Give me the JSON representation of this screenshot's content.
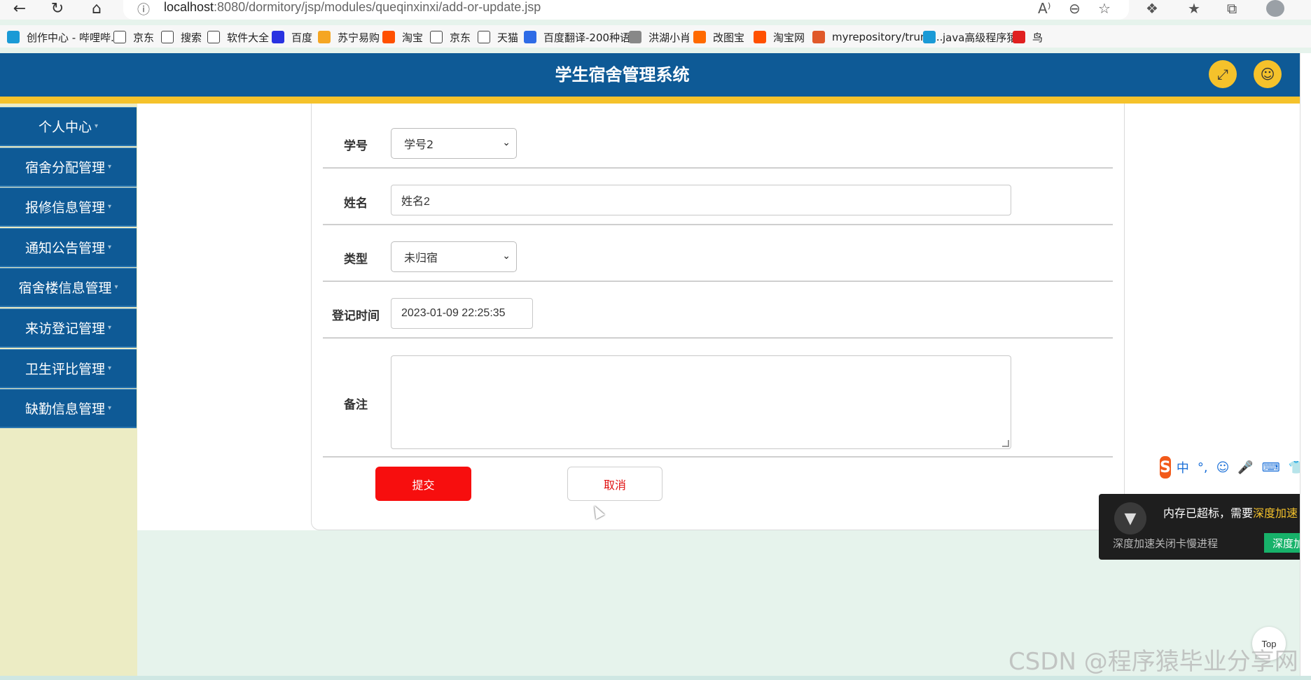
{
  "browser": {
    "url_host": "localhost",
    "url_rest": ":8080/dormitory/jsp/modules/queqinxinxi/add-or-update.jsp",
    "bookmarks": [
      {
        "label": "创作中心 - 哔哩哔...",
        "color": "#1a9ad6"
      },
      {
        "label": "京东",
        "color": "#ffffff"
      },
      {
        "label": "搜索",
        "color": "#ffffff"
      },
      {
        "label": "软件大全",
        "color": "#ffffff"
      },
      {
        "label": "百度",
        "color": "#2932e1"
      },
      {
        "label": "苏宁易购",
        "color": "#f5a623"
      },
      {
        "label": "淘宝",
        "color": "#ff5000"
      },
      {
        "label": "京东",
        "color": "#ffffff"
      },
      {
        "label": "天猫",
        "color": "#ffffff"
      },
      {
        "label": "百度翻译-200种语...",
        "color": "#2e6be6"
      },
      {
        "label": "洪湖小肖",
        "color": "#888888"
      },
      {
        "label": "改图宝",
        "color": "#ff6a00"
      },
      {
        "label": "淘宝网",
        "color": "#ff5000"
      },
      {
        "label": "myrepository/trunk...",
        "color": "#e0592a"
      },
      {
        "label": "java高级程序猿",
        "color": "#1a9ad6"
      },
      {
        "label": "鸟",
        "color": "#e02020"
      }
    ]
  },
  "app": {
    "title": "学生宿舍管理系统"
  },
  "sidebar": {
    "items": [
      {
        "label": "个人中心"
      },
      {
        "label": "宿舍分配管理"
      },
      {
        "label": "报修信息管理"
      },
      {
        "label": "通知公告管理"
      },
      {
        "label": "宿舍楼信息管理"
      },
      {
        "label": "来访登记管理"
      },
      {
        "label": "卫生评比管理"
      },
      {
        "label": "缺勤信息管理"
      }
    ]
  },
  "form": {
    "student_id": {
      "label": "学号",
      "value": "学号2"
    },
    "name": {
      "label": "姓名",
      "value": "姓名2"
    },
    "type": {
      "label": "类型",
      "value": "未归宿"
    },
    "time": {
      "label": "登记时间",
      "value": "2023-01-09 22:25:35"
    },
    "remark": {
      "label": "备注",
      "value": ""
    },
    "submit_label": "提交",
    "cancel_label": "取消"
  },
  "ime": {
    "logo": "S",
    "items": [
      "中",
      "°,",
      "☺",
      "🎤",
      "⌨",
      "👕"
    ]
  },
  "popup": {
    "main": "内存已超标，需要",
    "highlight": "深度加速",
    "sub": "深度加速关闭卡慢进程",
    "button": "深度加速"
  },
  "top_button": "Top",
  "watermark": "CSDN @程序猿毕业分享网"
}
